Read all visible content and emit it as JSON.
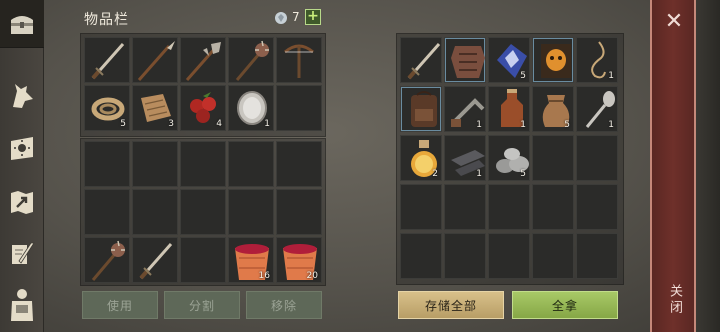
{
  "header": {
    "title": "物品栏",
    "gem_count": "7",
    "add_label": "+"
  },
  "sidebar": {
    "tabs": [
      {
        "icon": "chest-icon",
        "selected": true
      },
      {
        "icon": "wolf-head-icon"
      },
      {
        "icon": "sun-book-icon"
      },
      {
        "icon": "map-arrow-icon"
      },
      {
        "icon": "scroll-quill-icon"
      },
      {
        "icon": "backpack-figure-icon"
      }
    ]
  },
  "inventory": {
    "slots": [
      {
        "icon": "sword-icon",
        "count": ""
      },
      {
        "icon": "spear-icon",
        "count": ""
      },
      {
        "icon": "halberd-icon",
        "count": ""
      },
      {
        "icon": "mace-icon",
        "count": ""
      },
      {
        "icon": "crossbow-icon",
        "count": ""
      },
      {
        "icon": "rope-icon",
        "count": "5"
      },
      {
        "icon": "leather-scraps-icon",
        "count": "3"
      },
      {
        "icon": "berries-icon",
        "count": "4"
      },
      {
        "icon": "mirror-shield-icon",
        "count": "1"
      },
      {
        "icon": "",
        "count": ""
      }
    ],
    "hotbar": [
      {
        "icon": "mace-icon",
        "count": ""
      },
      {
        "icon": "sword-icon",
        "count": ""
      },
      {
        "icon": "",
        "count": ""
      },
      {
        "icon": "berry-bucket-icon",
        "count": "16"
      },
      {
        "icon": "berry-bucket-icon",
        "count": "20"
      }
    ],
    "buttons": {
      "use": "使用",
      "split": "分割",
      "remove": "移除"
    }
  },
  "storage": {
    "slots": [
      {
        "icon": "sword-icon",
        "count": ""
      },
      {
        "icon": "armor-icon",
        "count": ""
      },
      {
        "icon": "crystal-icon",
        "count": "5"
      },
      {
        "icon": "mask-book-icon",
        "count": ""
      },
      {
        "icon": "noose-icon",
        "count": "1"
      },
      {
        "icon": "backpack-icon",
        "count": ""
      },
      {
        "icon": "crank-icon",
        "count": "1"
      },
      {
        "icon": "bottle-icon",
        "count": "1"
      },
      {
        "icon": "sack-icon",
        "count": "5"
      },
      {
        "icon": "spoon-icon",
        "count": "1"
      },
      {
        "icon": "potion-icon",
        "count": "2"
      },
      {
        "icon": "iron-ingots-icon",
        "count": "1"
      },
      {
        "icon": "stone-pile-icon",
        "count": "5"
      }
    ],
    "buttons": {
      "store_all": "存储全部",
      "take_all": "全拿"
    }
  },
  "close": {
    "label": "关闭",
    "icon": "close-icon"
  },
  "colors": {
    "accent_green": "#a8c967",
    "accent_gold": "#d8c08a",
    "close_red": "#6e302a"
  }
}
